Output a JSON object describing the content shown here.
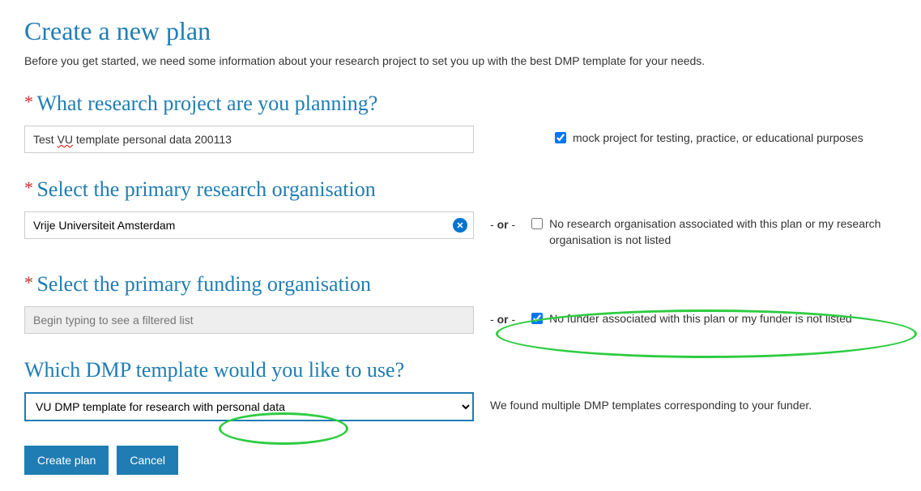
{
  "page": {
    "title": "Create a new plan",
    "intro": "Before you get started, we need some information about your research project to set you up with the best DMP template for your needs."
  },
  "project": {
    "label": "What research project are you planning?",
    "value_prefix": "Test ",
    "value_misspelled": "VU",
    "value_suffix": " template personal data 200113",
    "checkbox_label": "mock project for testing, practice, or educational purposes",
    "checked": true
  },
  "research_org": {
    "label": "Select the primary research organisation",
    "value": "Vrije Universiteit Amsterdam",
    "or": "- or -",
    "checkbox_label": "No research organisation associated with this plan or my research organisation is not listed",
    "checked": false
  },
  "funding_org": {
    "label": "Select the primary funding organisation",
    "placeholder": "Begin typing to see a filtered list",
    "or": "- or -",
    "checkbox_label": "No funder associated with this plan or my funder is not listed",
    "checked": true
  },
  "template": {
    "label": "Which DMP template would you like to use?",
    "selected": "VU DMP template for research with personal data",
    "note": "We found multiple DMP templates corresponding to your funder."
  },
  "buttons": {
    "create": "Create plan",
    "cancel": "Cancel"
  },
  "asterisk": "*"
}
